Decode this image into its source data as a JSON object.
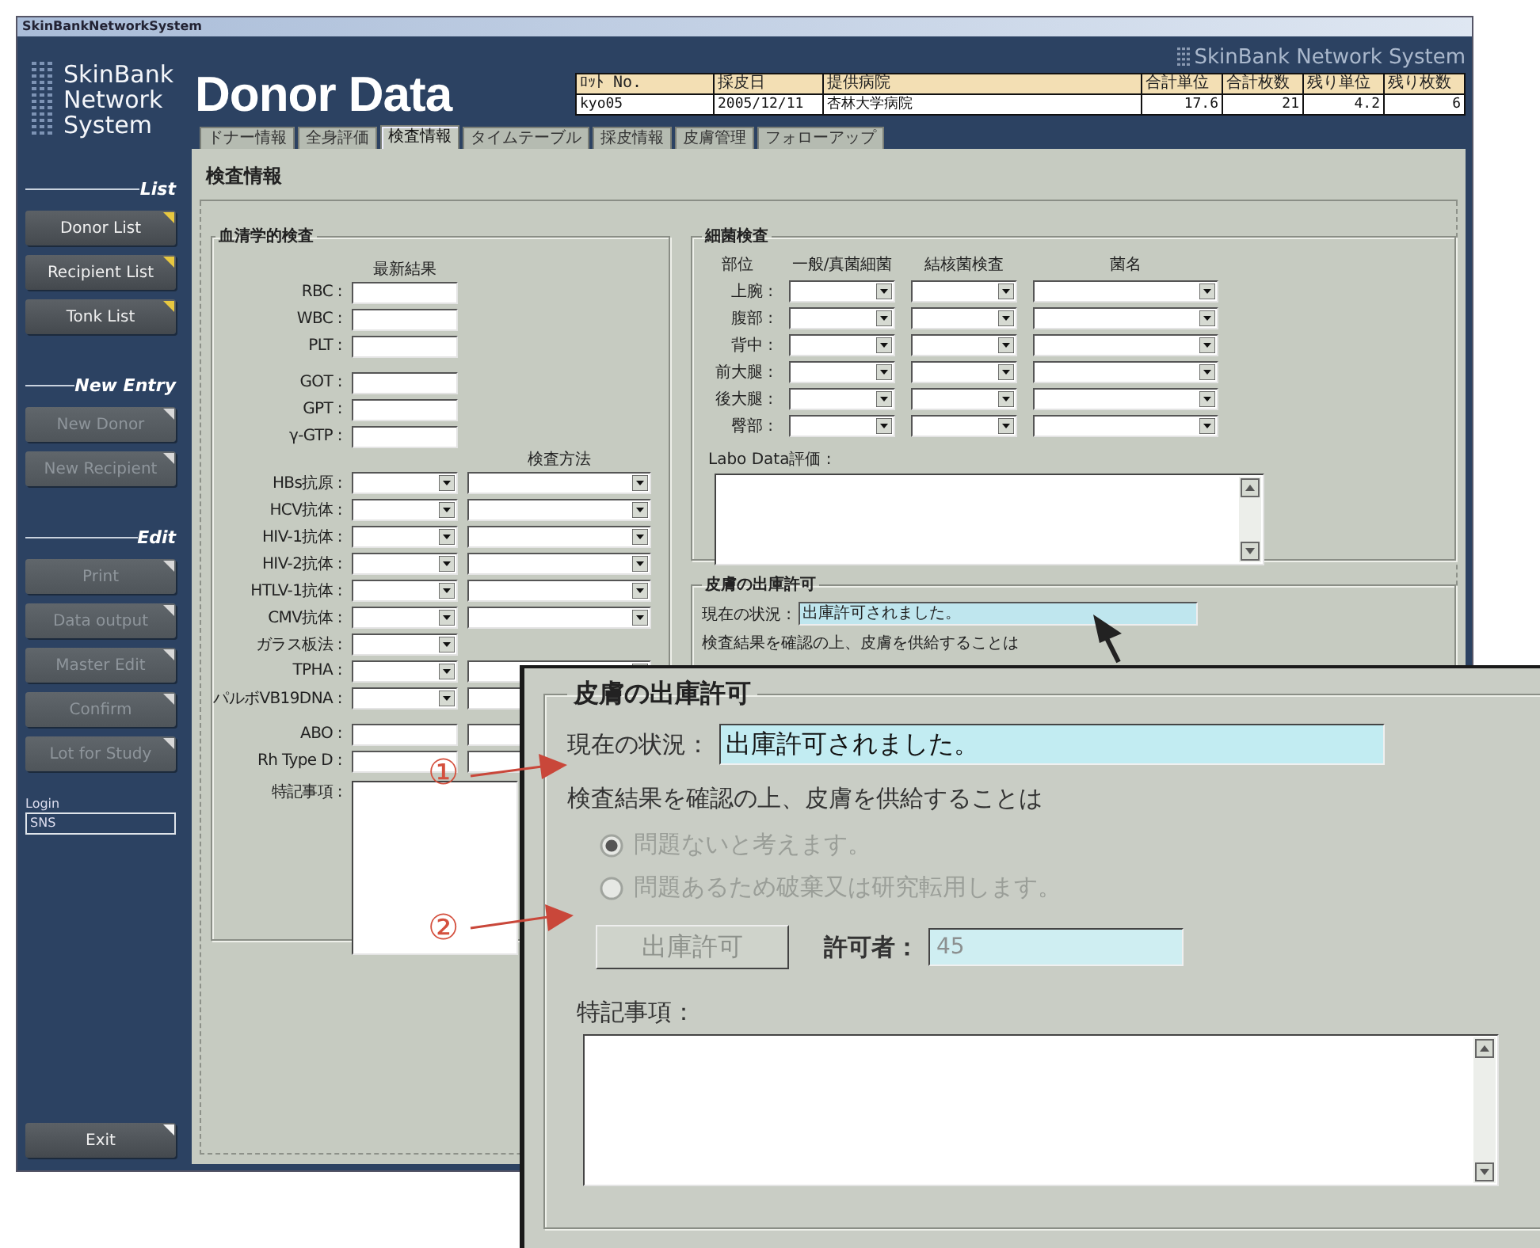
{
  "window": {
    "title": "SkinBankNetworkSystem"
  },
  "sidebar": {
    "logo": [
      "SkinBank",
      "Network",
      "System"
    ],
    "sections": [
      {
        "heading": "List",
        "buttons": [
          {
            "label": "Donor List",
            "disabled": false
          },
          {
            "label": "Recipient List",
            "disabled": false
          },
          {
            "label": "Tonk List",
            "disabled": false
          }
        ]
      },
      {
        "heading": "New Entry",
        "buttons": [
          {
            "label": "New Donor",
            "disabled": true
          },
          {
            "label": "New Recipient",
            "disabled": true
          }
        ]
      },
      {
        "heading": "Edit",
        "buttons": [
          {
            "label": "Print",
            "disabled": true
          },
          {
            "label": "Data output",
            "disabled": true
          },
          {
            "label": "Master Edit",
            "disabled": true
          },
          {
            "label": "Confirm",
            "disabled": true
          },
          {
            "label": "Lot for Study",
            "disabled": true
          }
        ]
      }
    ],
    "login": {
      "label": "Login",
      "value": "SNS"
    },
    "exit_button": "Exit"
  },
  "header": {
    "title": "Donor Data",
    "brand": "SkinBank Network System"
  },
  "summary_table": {
    "columns": [
      "ﾛｯﾄ No.",
      "採皮日",
      "提供病院",
      "合計単位",
      "合計枚数",
      "残り単位",
      "残り枚数"
    ],
    "row": [
      "kyo05",
      "2005/12/11",
      "杏林大学病院",
      "17.6",
      "21",
      "4.2",
      "6"
    ]
  },
  "tabs": [
    {
      "label": "ドナー情報",
      "selected": false
    },
    {
      "label": "全身評価",
      "selected": false
    },
    {
      "label": "検査情報",
      "selected": true
    },
    {
      "label": "タイムテーブル",
      "selected": false
    },
    {
      "label": "採皮情報",
      "selected": false
    },
    {
      "label": "皮膚管理",
      "selected": false
    },
    {
      "label": "フォローアップ",
      "selected": false
    }
  ],
  "page_heading": "検査情報",
  "serology": {
    "title": "血清学的検査",
    "groups": [
      {
        "result_header": "最新結果",
        "rows": [
          {
            "label": "RBC :",
            "kind": "text"
          },
          {
            "label": "WBC :",
            "kind": "text"
          },
          {
            "label": "PLT :",
            "kind": "text"
          }
        ]
      },
      {
        "rows": [
          {
            "label": "GOT :",
            "kind": "text"
          },
          {
            "label": "GPT :",
            "kind": "text"
          },
          {
            "label": "γ-GTP :",
            "kind": "text"
          }
        ]
      },
      {
        "method_header": "検査方法",
        "rows": [
          {
            "label": "HBs抗原 :",
            "kind": "select_pair"
          },
          {
            "label": "HCV抗体 :",
            "kind": "select_pair"
          },
          {
            "label": "HIV-1抗体 :",
            "kind": "select_pair"
          },
          {
            "label": "HIV-2抗体 :",
            "kind": "select_pair"
          },
          {
            "label": "HTLV-1抗体 :",
            "kind": "select_pair"
          },
          {
            "label": "CMV抗体 :",
            "kind": "select_pair"
          },
          {
            "label": "ガラス板法 :",
            "kind": "select"
          },
          {
            "label": "TPHA :",
            "kind": "select_pair"
          },
          {
            "label": "パルボVB19DNA :",
            "kind": "select_pair"
          }
        ]
      },
      {
        "rows": [
          {
            "label": "ABO :",
            "kind": "text_pair"
          },
          {
            "label": "Rh Type D :",
            "kind": "text_pair"
          }
        ]
      }
    ],
    "notes_label": "特記事項 :"
  },
  "bacteria": {
    "title": "細菌検査",
    "columns": [
      "部位",
      "一般/真菌細菌",
      "結核菌検査",
      "菌名"
    ],
    "rows": [
      "上腕 :",
      "腹部 :",
      "背中 :",
      "前大腿 :",
      "後大腿 :",
      "臀部 :"
    ],
    "labo_label": "Labo Data評価 :"
  },
  "release": {
    "title": "皮膚の出庫許可",
    "status_label": "現在の状況 :",
    "status_value": "出庫許可されました。",
    "question": "検査結果を確認の上、皮膚を供給することは"
  },
  "callout": {
    "title": "皮膚の出庫許可",
    "status_label": "現在の状況：",
    "status_value": "出庫許可されました。",
    "question": "検査結果を確認の上、皮膚を供給することは",
    "options_disabled": true,
    "options": [
      {
        "label": "問題ないと考えます。",
        "selected": true
      },
      {
        "label": "問題あるため破棄又は研究転用します。",
        "selected": false
      }
    ],
    "button": {
      "label": "出庫許可",
      "disabled": true
    },
    "approver_label": "許可者：",
    "approver_value": "45",
    "notes_label": "特記事項："
  },
  "markers": [
    "①",
    "②"
  ]
}
